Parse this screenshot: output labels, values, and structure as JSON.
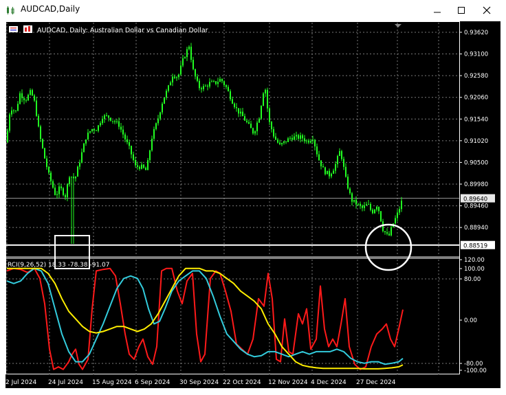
{
  "window": {
    "title": "AUDCAD,Daily",
    "controls": [
      "minimize-icon",
      "maximize-icon",
      "close-icon"
    ]
  },
  "chart_header": {
    "text": "AUDCAD, Daily:  Australian Dollar vs Canadian Dollar"
  },
  "indicator_header": {
    "text": "RCI(9,26,52) 18.33 -78.38 -91.07"
  },
  "colors": {
    "background": "#000000",
    "grid": "#7a7a7a",
    "candles": "#22ff22",
    "rci_short": "#ff1a1a",
    "rci_mid": "#33ccdd",
    "rci_long": "#ffee00",
    "annotation": "#ffffff"
  },
  "chart_data": [
    {
      "type": "candlestick",
      "symbol": "AUDCAD",
      "timeframe": "Daily",
      "title": "AUDCAD, Daily:  Australian Dollar vs Canadian Dollar",
      "price_ticks": [
        "0.93620",
        "0.93100",
        "0.92580",
        "0.92060",
        "0.91540",
        "0.91020",
        "0.90500",
        "0.89980",
        "0.89460",
        "0.88940"
      ],
      "current_price_label": "0.89640",
      "marked_level_label": "0.88519",
      "date_labels": [
        "2 Jul 2024",
        "24 Jul 2024",
        "15 Aug 2024",
        "6 Sep 2024",
        "30 Sep 2024",
        "22 Oct 2024",
        "12 Nov 2024",
        "4 Dec 2024",
        "27 Dec 2024"
      ],
      "close_path": [
        [
          0,
          0.9098
        ],
        [
          6,
          0.9182
        ],
        [
          14,
          0.9172
        ],
        [
          20,
          0.9215
        ],
        [
          28,
          0.92
        ],
        [
          36,
          0.922
        ],
        [
          42,
          0.919
        ],
        [
          48,
          0.912
        ],
        [
          56,
          0.906
        ],
        [
          62,
          0.902
        ],
        [
          68,
          0.899
        ],
        [
          72,
          0.897
        ],
        [
          78,
          0.899
        ],
        [
          86,
          0.897
        ],
        [
          92,
          0.902
        ],
        [
          100,
          0.901
        ],
        [
          108,
          0.906
        ],
        [
          116,
          0.911
        ],
        [
          124,
          0.913
        ],
        [
          132,
          0.913
        ],
        [
          140,
          0.916
        ],
        [
          148,
          0.916
        ],
        [
          156,
          0.915
        ],
        [
          164,
          0.914
        ],
        [
          172,
          0.911
        ],
        [
          180,
          0.908
        ],
        [
          188,
          0.904
        ],
        [
          196,
          0.904
        ],
        [
          204,
          0.903
        ],
        [
          212,
          0.911
        ],
        [
          220,
          0.915
        ],
        [
          228,
          0.92
        ],
        [
          236,
          0.923
        ],
        [
          242,
          0.926
        ],
        [
          250,
          0.9255
        ],
        [
          258,
          0.93
        ],
        [
          266,
          0.933
        ],
        [
          272,
          0.927
        ],
        [
          280,
          0.923
        ],
        [
          288,
          0.923
        ],
        [
          296,
          0.924
        ],
        [
          304,
          0.924
        ],
        [
          312,
          0.925
        ],
        [
          320,
          0.923
        ],
        [
          328,
          0.92
        ],
        [
          336,
          0.9175
        ],
        [
          344,
          0.916
        ],
        [
          352,
          0.914
        ],
        [
          360,
          0.912
        ],
        [
          368,
          0.916
        ],
        [
          376,
          0.924
        ],
        [
          382,
          0.915
        ],
        [
          390,
          0.911
        ],
        [
          398,
          0.909
        ],
        [
          406,
          0.91
        ],
        [
          414,
          0.911
        ],
        [
          422,
          0.911
        ],
        [
          430,
          0.911
        ],
        [
          438,
          0.91
        ],
        [
          446,
          0.911
        ],
        [
          454,
          0.906
        ],
        [
          462,
          0.903
        ],
        [
          470,
          0.902
        ],
        [
          478,
          0.904
        ],
        [
          486,
          0.908
        ],
        [
          494,
          0.901
        ],
        [
          502,
          0.896
        ],
        [
          510,
          0.895
        ],
        [
          518,
          0.894
        ],
        [
          526,
          0.895
        ],
        [
          532,
          0.893
        ],
        [
          540,
          0.895
        ],
        [
          548,
          0.889
        ],
        [
          556,
          0.887
        ],
        [
          562,
          0.89
        ],
        [
          570,
          0.893
        ],
        [
          576,
          0.896
        ]
      ],
      "annotations": [
        {
          "shape": "rectangle",
          "note": "July 2024 spike low"
        },
        {
          "shape": "circle",
          "note": "late December 2024 low"
        }
      ]
    },
    {
      "type": "line",
      "title": "RCI(9,26,52) 18.33 -78.38 -91.07",
      "ticks": [
        "120.00",
        "100.00",
        "80.00",
        "0.00",
        "-80.00",
        "-100.00"
      ],
      "ylim": [
        -100,
        120
      ],
      "series": [
        {
          "name": "RCI 9",
          "last": 18.33,
          "points": [
            [
              0,
              95
            ],
            [
              10,
              100
            ],
            [
              20,
              98
            ],
            [
              30,
              92
            ],
            [
              40,
              100
            ],
            [
              48,
              80
            ],
            [
              55,
              30
            ],
            [
              62,
              -60
            ],
            [
              68,
              -100
            ],
            [
              75,
              -95
            ],
            [
              82,
              -100
            ],
            [
              90,
              -85
            ],
            [
              95,
              -70
            ],
            [
              100,
              -60
            ],
            [
              105,
              -90
            ],
            [
              110,
              -100
            ],
            [
              118,
              -80
            ],
            [
              124,
              20
            ],
            [
              130,
              95
            ],
            [
              140,
              98
            ],
            [
              150,
              100
            ],
            [
              158,
              85
            ],
            [
              165,
              30
            ],
            [
              172,
              -30
            ],
            [
              178,
              -70
            ],
            [
              185,
              -80
            ],
            [
              192,
              -55
            ],
            [
              198,
              -40
            ],
            [
              205,
              -75
            ],
            [
              212,
              -90
            ],
            [
              218,
              -55
            ],
            [
              225,
              95
            ],
            [
              232,
              100
            ],
            [
              240,
              100
            ],
            [
              248,
              55
            ],
            [
              255,
              30
            ],
            [
              262,
              75
            ],
            [
              270,
              90
            ],
            [
              276,
              -30
            ],
            [
              282,
              -85
            ],
            [
              288,
              -70
            ],
            [
              296,
              80
            ],
            [
              304,
              95
            ],
            [
              310,
              90
            ],
            [
              318,
              55
            ],
            [
              326,
              15
            ],
            [
              334,
              -50
            ],
            [
              342,
              -60
            ],
            [
              350,
              -70
            ],
            [
              358,
              -40
            ],
            [
              366,
              40
            ],
            [
              374,
              25
            ],
            [
              380,
              90
            ],
            [
              386,
              40
            ],
            [
              392,
              -80
            ],
            [
              398,
              -85
            ],
            [
              404,
              0
            ],
            [
              410,
              -65
            ],
            [
              416,
              -70
            ],
            [
              424,
              10
            ],
            [
              430,
              -10
            ],
            [
              436,
              20
            ],
            [
              442,
              -60
            ],
            [
              450,
              -40
            ],
            [
              456,
              65
            ],
            [
              462,
              -20
            ],
            [
              468,
              -55
            ],
            [
              474,
              -40
            ],
            [
              480,
              -55
            ],
            [
              486,
              -10
            ],
            [
              492,
              40
            ],
            [
              498,
              -55
            ],
            [
              506,
              -90
            ],
            [
              514,
              -100
            ],
            [
              522,
              -95
            ],
            [
              530,
              -55
            ],
            [
              538,
              -30
            ],
            [
              546,
              -20
            ],
            [
              552,
              -10
            ],
            [
              558,
              -40
            ],
            [
              564,
              -55
            ],
            [
              570,
              -20
            ],
            [
              576,
              18.33
            ]
          ]
        },
        {
          "name": "RCI 26",
          "last": -78.38,
          "points": [
            [
              0,
              75
            ],
            [
              10,
              70
            ],
            [
              20,
              75
            ],
            [
              30,
              90
            ],
            [
              40,
              100
            ],
            [
              50,
              95
            ],
            [
              60,
              70
            ],
            [
              70,
              20
            ],
            [
              80,
              -30
            ],
            [
              90,
              -65
            ],
            [
              100,
              -85
            ],
            [
              110,
              -85
            ],
            [
              120,
              -70
            ],
            [
              130,
              -40
            ],
            [
              140,
              -10
            ],
            [
              150,
              25
            ],
            [
              160,
              60
            ],
            [
              170,
              80
            ],
            [
              180,
              85
            ],
            [
              190,
              80
            ],
            [
              198,
              60
            ],
            [
              206,
              20
            ],
            [
              214,
              -10
            ],
            [
              222,
              -5
            ],
            [
              230,
              20
            ],
            [
              240,
              55
            ],
            [
              250,
              75
            ],
            [
              260,
              85
            ],
            [
              270,
              95
            ],
            [
              280,
              95
            ],
            [
              290,
              80
            ],
            [
              300,
              45
            ],
            [
              310,
              5
            ],
            [
              320,
              -30
            ],
            [
              330,
              -45
            ],
            [
              340,
              -60
            ],
            [
              350,
              -70
            ],
            [
              360,
              -75
            ],
            [
              370,
              -73
            ],
            [
              380,
              -65
            ],
            [
              390,
              -65
            ],
            [
              400,
              -70
            ],
            [
              410,
              -75
            ],
            [
              420,
              -70
            ],
            [
              430,
              -65
            ],
            [
              440,
              -70
            ],
            [
              450,
              -65
            ],
            [
              460,
              -65
            ],
            [
              470,
              -65
            ],
            [
              480,
              -60
            ],
            [
              490,
              -65
            ],
            [
              500,
              -78
            ],
            [
              510,
              -85
            ],
            [
              520,
              -88
            ],
            [
              530,
              -85
            ],
            [
              540,
              -85
            ],
            [
              550,
              -90
            ],
            [
              560,
              -88
            ],
            [
              570,
              -85
            ],
            [
              576,
              -78.38
            ]
          ]
        },
        {
          "name": "RCI 52",
          "last": -91.07,
          "points": [
            [
              0,
              100
            ],
            [
              20,
              100
            ],
            [
              40,
              100
            ],
            [
              50,
              100
            ],
            [
              60,
              90
            ],
            [
              70,
              70
            ],
            [
              80,
              40
            ],
            [
              90,
              15
            ],
            [
              100,
              0
            ],
            [
              110,
              -15
            ],
            [
              120,
              -25
            ],
            [
              130,
              -28
            ],
            [
              140,
              -25
            ],
            [
              150,
              -20
            ],
            [
              160,
              -15
            ],
            [
              170,
              -15
            ],
            [
              180,
              -20
            ],
            [
              190,
              -25
            ],
            [
              200,
              -20
            ],
            [
              210,
              -10
            ],
            [
              220,
              10
            ],
            [
              230,
              35
            ],
            [
              240,
              60
            ],
            [
              250,
              85
            ],
            [
              260,
              100
            ],
            [
              270,
              100
            ],
            [
              280,
              100
            ],
            [
              290,
              95
            ],
            [
              300,
              95
            ],
            [
              310,
              90
            ],
            [
              320,
              80
            ],
            [
              330,
              70
            ],
            [
              340,
              55
            ],
            [
              350,
              45
            ],
            [
              360,
              35
            ],
            [
              370,
              20
            ],
            [
              380,
              -10
            ],
            [
              390,
              -30
            ],
            [
              400,
              -55
            ],
            [
              410,
              -70
            ],
            [
              420,
              -85
            ],
            [
              430,
              -92
            ],
            [
              440,
              -95
            ],
            [
              450,
              -97
            ],
            [
              460,
              -98
            ],
            [
              470,
              -98
            ],
            [
              480,
              -98
            ],
            [
              490,
              -98
            ],
            [
              500,
              -98
            ],
            [
              510,
              -98
            ],
            [
              520,
              -99
            ],
            [
              530,
              -99
            ],
            [
              540,
              -99
            ],
            [
              550,
              -98
            ],
            [
              560,
              -97
            ],
            [
              570,
              -95
            ],
            [
              576,
              -91.07
            ]
          ]
        }
      ]
    }
  ]
}
